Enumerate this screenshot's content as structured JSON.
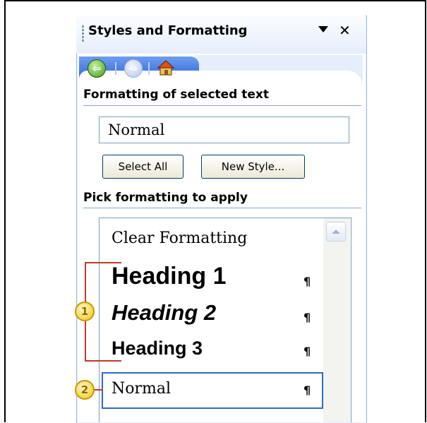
{
  "pane": {
    "title": "Styles and Formatting",
    "menu_icon": "dropdown-arrow-icon",
    "close_icon": "close-icon"
  },
  "nav": {
    "back_icon": "back-arrow-icon",
    "forward_icon": "forward-arrow-icon",
    "home_icon": "home-icon"
  },
  "formatting": {
    "heading": "Formatting of selected text",
    "current_style": "Normal",
    "select_all_label": "Select All",
    "new_style_label": "New Style..."
  },
  "pick": {
    "heading": "Pick formatting to apply",
    "items": [
      {
        "label": "Clear Formatting",
        "pilcrow": ""
      },
      {
        "label": "Heading 1",
        "pilcrow": "¶"
      },
      {
        "label": "Heading 2",
        "pilcrow": "¶"
      },
      {
        "label": "Heading 3",
        "pilcrow": "¶"
      },
      {
        "label": "Normal",
        "pilcrow": "¶"
      }
    ]
  },
  "callouts": {
    "one": "1",
    "two": "2"
  },
  "colors": {
    "nav_strip": "#2f63d4",
    "selection_border": "#316ac5",
    "callout_line": "#c0392b",
    "callout_badge": "#f5c518"
  }
}
